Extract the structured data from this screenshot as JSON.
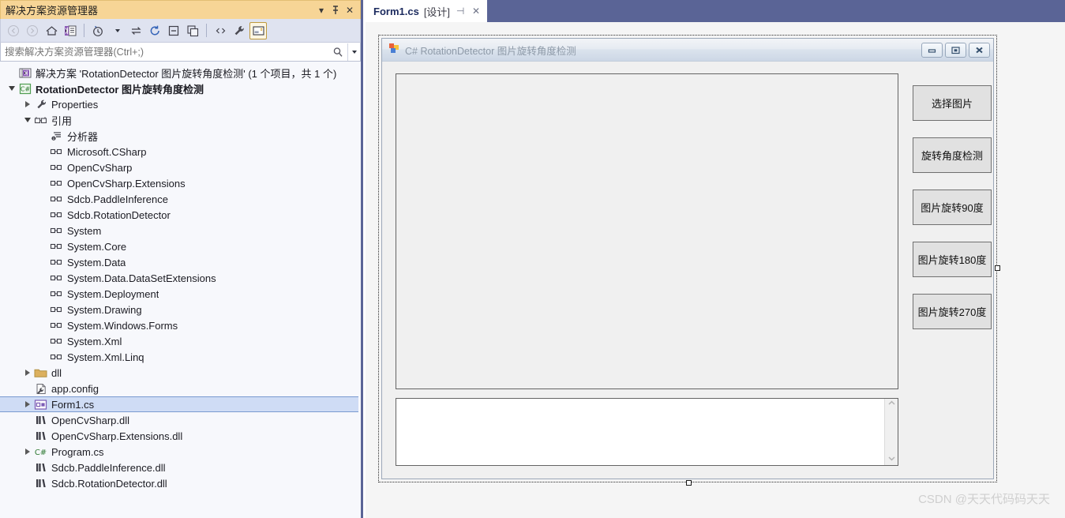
{
  "solution_explorer": {
    "title": "解决方案资源管理器",
    "titlebar_buttons": [
      {
        "name": "dropdown",
        "glyph": "▾"
      },
      {
        "name": "pin",
        "glyph": "⚲"
      },
      {
        "name": "close",
        "glyph": "✕"
      }
    ],
    "toolbar": [
      {
        "name": "back-icon",
        "glyph": "◄",
        "dim": true,
        "active": false
      },
      {
        "name": "forward-icon",
        "glyph": "►",
        "dim": true,
        "active": false
      },
      {
        "name": "home-icon",
        "glyph": "⌂",
        "dim": false,
        "active": false
      },
      {
        "name": "solution-explorer-icon",
        "glyph": "▤",
        "dim": false,
        "active": false
      },
      {
        "name": "separator",
        "glyph": "",
        "dim": false,
        "active": false
      },
      {
        "name": "pending-changes-icon",
        "glyph": "◷",
        "dim": false,
        "active": false
      },
      {
        "name": "pending-changes-dropdown",
        "glyph": "▾",
        "dim": false,
        "active": false
      },
      {
        "name": "sync-with-active-document-icon",
        "glyph": "⇆",
        "dim": false,
        "active": false
      },
      {
        "name": "refresh-icon",
        "glyph": "↻",
        "dim": false,
        "active": false
      },
      {
        "name": "collapse-all-icon",
        "glyph": "⊟",
        "dim": false,
        "active": false
      },
      {
        "name": "show-all-files-icon",
        "glyph": "❐",
        "dim": false,
        "active": false
      },
      {
        "name": "separator",
        "glyph": "",
        "dim": false,
        "active": false
      },
      {
        "name": "view-code-icon",
        "glyph": "‹›",
        "dim": false,
        "active": false
      },
      {
        "name": "properties-icon",
        "glyph": "🔧",
        "dim": false,
        "active": false
      },
      {
        "name": "view-designer-icon",
        "glyph": "▱",
        "dim": false,
        "active": true
      }
    ],
    "search": {
      "value": "",
      "placeholder": "搜索解决方案资源管理器(Ctrl+;)"
    },
    "tree": [
      {
        "indent": 0,
        "expander": "none",
        "icon": "solution-icon",
        "label": "解决方案 'RotationDetector 图片旋转角度检测' (1 个项目，共 1 个)",
        "bold": false,
        "selected": false
      },
      {
        "indent": 0,
        "expander": "open",
        "icon": "csharp-project-icon",
        "label": "RotationDetector 图片旋转角度检测",
        "bold": true,
        "selected": false
      },
      {
        "indent": 1,
        "expander": "closed",
        "icon": "wrench-icon",
        "label": "Properties",
        "bold": false,
        "selected": false
      },
      {
        "indent": 1,
        "expander": "open",
        "icon": "references-icon",
        "label": "引用",
        "bold": false,
        "selected": false
      },
      {
        "indent": 2,
        "expander": "none",
        "icon": "analyzers-icon",
        "label": "分析器",
        "bold": false,
        "selected": false
      },
      {
        "indent": 2,
        "expander": "none",
        "icon": "reference-icon",
        "label": "Microsoft.CSharp",
        "bold": false,
        "selected": false
      },
      {
        "indent": 2,
        "expander": "none",
        "icon": "reference-icon",
        "label": "OpenCvSharp",
        "bold": false,
        "selected": false
      },
      {
        "indent": 2,
        "expander": "none",
        "icon": "reference-icon",
        "label": "OpenCvSharp.Extensions",
        "bold": false,
        "selected": false
      },
      {
        "indent": 2,
        "expander": "none",
        "icon": "reference-icon",
        "label": "Sdcb.PaddleInference",
        "bold": false,
        "selected": false
      },
      {
        "indent": 2,
        "expander": "none",
        "icon": "reference-icon",
        "label": "Sdcb.RotationDetector",
        "bold": false,
        "selected": false
      },
      {
        "indent": 2,
        "expander": "none",
        "icon": "reference-icon",
        "label": "System",
        "bold": false,
        "selected": false
      },
      {
        "indent": 2,
        "expander": "none",
        "icon": "reference-icon",
        "label": "System.Core",
        "bold": false,
        "selected": false
      },
      {
        "indent": 2,
        "expander": "none",
        "icon": "reference-icon",
        "label": "System.Data",
        "bold": false,
        "selected": false
      },
      {
        "indent": 2,
        "expander": "none",
        "icon": "reference-icon",
        "label": "System.Data.DataSetExtensions",
        "bold": false,
        "selected": false
      },
      {
        "indent": 2,
        "expander": "none",
        "icon": "reference-icon",
        "label": "System.Deployment",
        "bold": false,
        "selected": false
      },
      {
        "indent": 2,
        "expander": "none",
        "icon": "reference-icon",
        "label": "System.Drawing",
        "bold": false,
        "selected": false
      },
      {
        "indent": 2,
        "expander": "none",
        "icon": "reference-icon",
        "label": "System.Windows.Forms",
        "bold": false,
        "selected": false
      },
      {
        "indent": 2,
        "expander": "none",
        "icon": "reference-icon",
        "label": "System.Xml",
        "bold": false,
        "selected": false
      },
      {
        "indent": 2,
        "expander": "none",
        "icon": "reference-icon",
        "label": "System.Xml.Linq",
        "bold": false,
        "selected": false
      },
      {
        "indent": 1,
        "expander": "closed",
        "icon": "folder-icon",
        "label": "dll",
        "bold": false,
        "selected": false
      },
      {
        "indent": 1,
        "expander": "none",
        "icon": "config-icon",
        "label": "app.config",
        "bold": false,
        "selected": false
      },
      {
        "indent": 1,
        "expander": "closed",
        "icon": "form-icon",
        "label": "Form1.cs",
        "bold": false,
        "selected": true
      },
      {
        "indent": 1,
        "expander": "none",
        "icon": "dll-icon",
        "label": "OpenCvSharp.dll",
        "bold": false,
        "selected": false
      },
      {
        "indent": 1,
        "expander": "none",
        "icon": "dll-icon",
        "label": "OpenCvSharp.Extensions.dll",
        "bold": false,
        "selected": false
      },
      {
        "indent": 1,
        "expander": "closed",
        "icon": "csharp-file-icon",
        "label": "Program.cs",
        "bold": false,
        "selected": false
      },
      {
        "indent": 1,
        "expander": "none",
        "icon": "dll-icon",
        "label": "Sdcb.PaddleInference.dll",
        "bold": false,
        "selected": false
      },
      {
        "indent": 1,
        "expander": "none",
        "icon": "dll-icon",
        "label": "Sdcb.RotationDetector.dll",
        "bold": false,
        "selected": false
      }
    ]
  },
  "editor": {
    "tab": {
      "name": "Form1.cs",
      "suffix": "[设计]",
      "pin_glyph": "⊣",
      "close_glyph": "✕"
    }
  },
  "form_designer": {
    "window": {
      "title": "C# RotationDetector 图片旋转角度检测",
      "caption_buttons": [
        {
          "name": "minimize-button",
          "glyph": "—"
        },
        {
          "name": "maximize-button",
          "glyph": "❐"
        },
        {
          "name": "close-button",
          "glyph": "✕"
        }
      ]
    },
    "picture_box": {
      "value": ""
    },
    "log_textbox": {
      "value": "",
      "scroll_up_glyph": "⌃",
      "scroll_down_glyph": "⌄"
    },
    "buttons": [
      {
        "name": "select-image-button",
        "label": "选择图片"
      },
      {
        "name": "detect-rotation-angle-button",
        "label": "旋转角度检测"
      },
      {
        "name": "rotate-90-button",
        "label": "图片旋转90度"
      },
      {
        "name": "rotate-180-button",
        "label": "图片旋转180度"
      },
      {
        "name": "rotate-270-button",
        "label": "图片旋转270度"
      }
    ]
  },
  "watermark": {
    "text": "CSDN @天天代码码天天"
  },
  "colors": {
    "panel_header": "#f7d596",
    "tabstrip": "#5a6496",
    "selection": "#cfdcf5",
    "toolbar": "#dfe3f0"
  }
}
